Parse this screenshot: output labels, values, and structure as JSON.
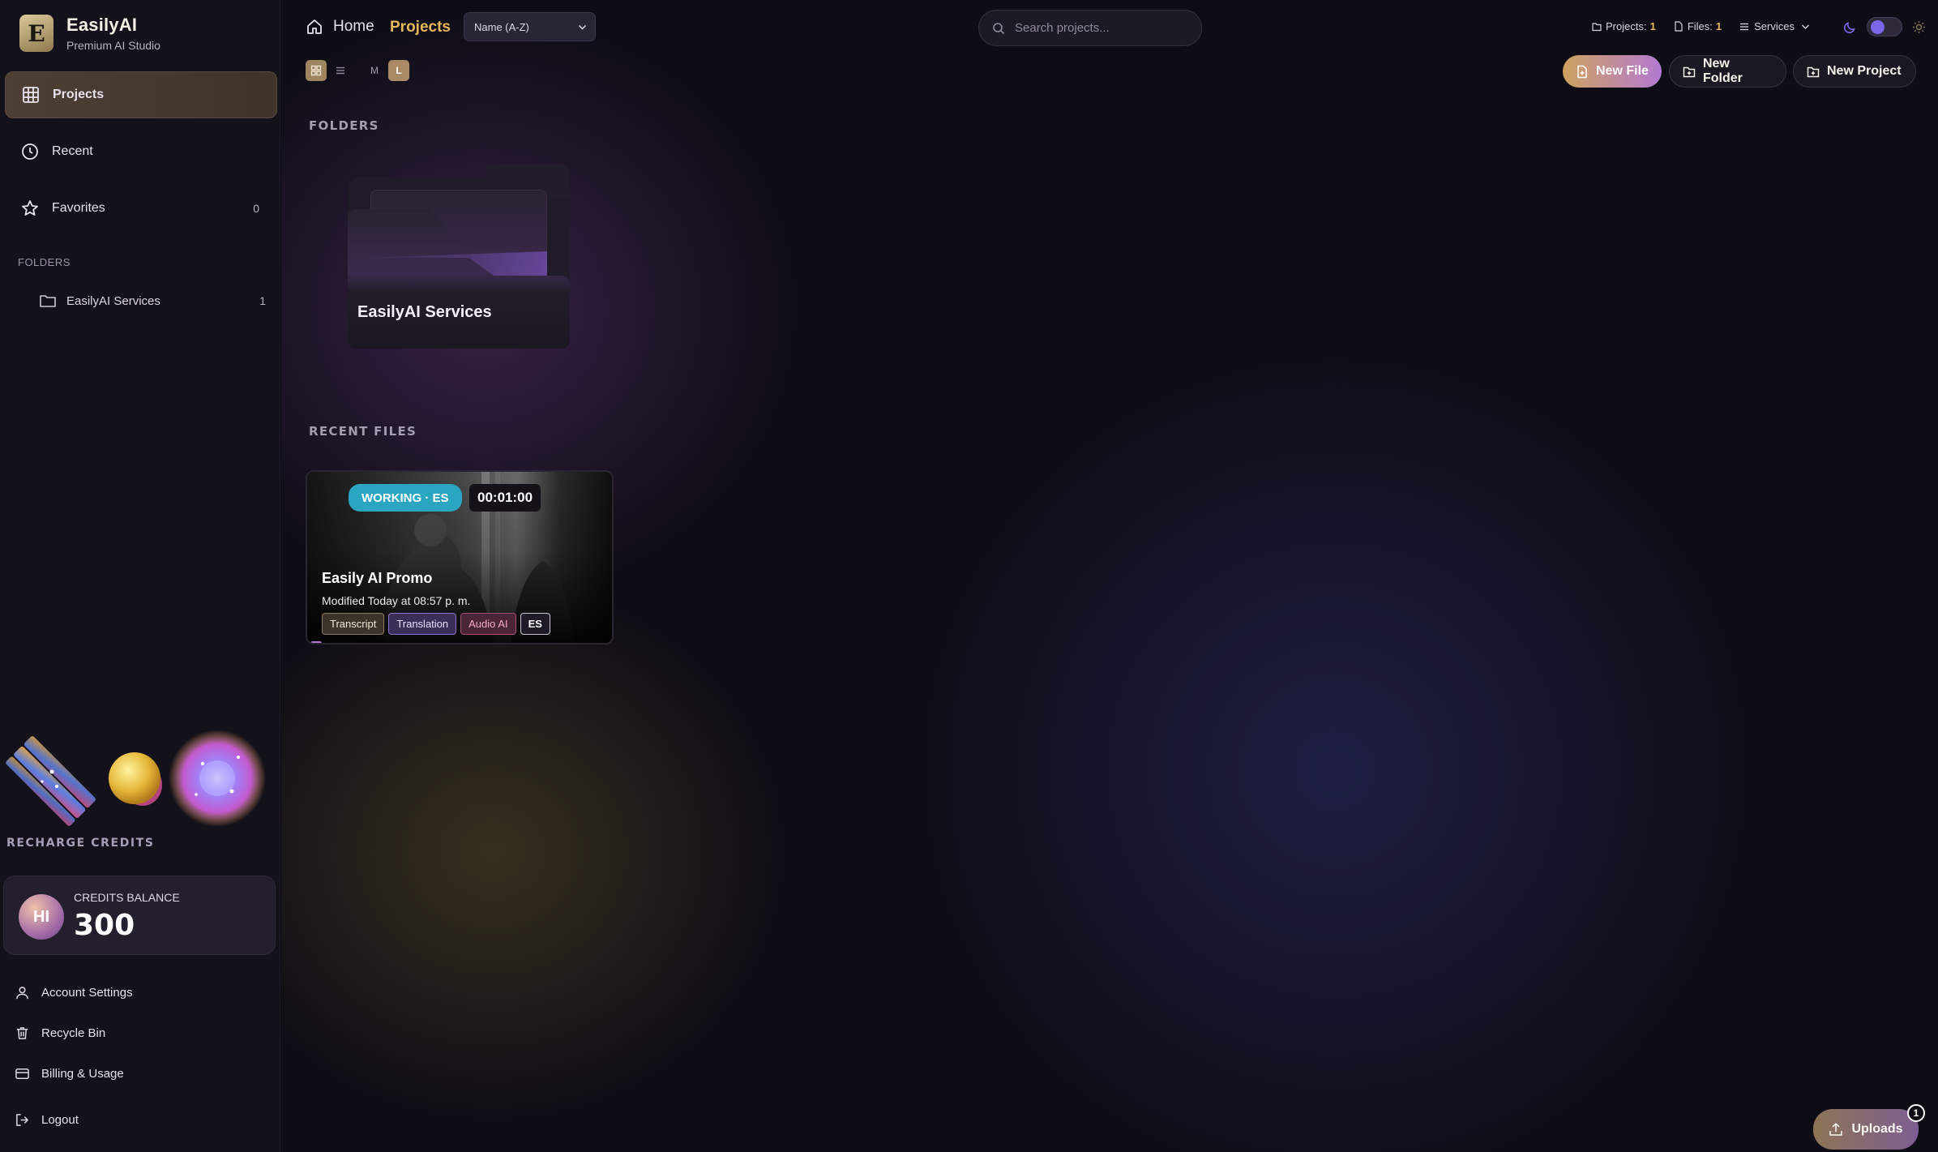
{
  "brand": {
    "name": "EasilyAI",
    "subtitle": "Premium AI Studio",
    "logo_letter": "E"
  },
  "sidebar": {
    "nav": [
      {
        "label": "Projects",
        "icon": "grid-icon",
        "active": true
      },
      {
        "label": "Recent",
        "icon": "clock-icon"
      },
      {
        "label": "Favorites",
        "icon": "star-icon",
        "count": "0"
      }
    ],
    "folders_label": "FOLDERS",
    "folders": [
      {
        "label": "EasilyAI Services",
        "count": "1",
        "icon": "folder-icon"
      }
    ],
    "recharge_label": "RECHARGE CREDITS",
    "credits": {
      "label": "CREDITS BALANCE",
      "value": "300",
      "avatar_initials": "HI"
    },
    "footer": [
      {
        "label": "Account Settings",
        "icon": "user-icon"
      },
      {
        "label": "Recycle Bin",
        "icon": "trash-icon"
      },
      {
        "label": "Billing & Usage",
        "icon": "credit-card-icon"
      },
      {
        "label": "Logout",
        "icon": "logout-icon"
      }
    ]
  },
  "header": {
    "home": "Home",
    "current": "Projects",
    "sort_value": "Name (A-Z)",
    "view_toggles": {
      "size_m": "M",
      "size_l": "L"
    },
    "search_placeholder": "Search projects...",
    "stats": {
      "projects_label": "Projects:",
      "projects_count": "1",
      "files_label": "Files:",
      "files_count": "1",
      "services_label": "Services"
    },
    "buttons": {
      "new_file": "New File",
      "new_folder": "New Folder",
      "new_project": "New Project"
    }
  },
  "content": {
    "folders_title": "FOLDERS",
    "folder_card": {
      "name": "EasilyAI Services"
    },
    "recent_title": "RECENT FILES",
    "file_card": {
      "status": "WORKING · ES",
      "duration": "00:01:00",
      "title": "Easily AI Promo",
      "modified": "Modified Today at 08:57 p. m.",
      "tags": [
        "Transcript",
        "Translation",
        "Audio AI",
        "ES"
      ]
    }
  },
  "uploads": {
    "label": "Uploads",
    "count": "1"
  },
  "colors": {
    "accent_gold": "#e7b85c",
    "working_badge": "#2ba6c0",
    "toggle_knob": "#7b67e8"
  }
}
